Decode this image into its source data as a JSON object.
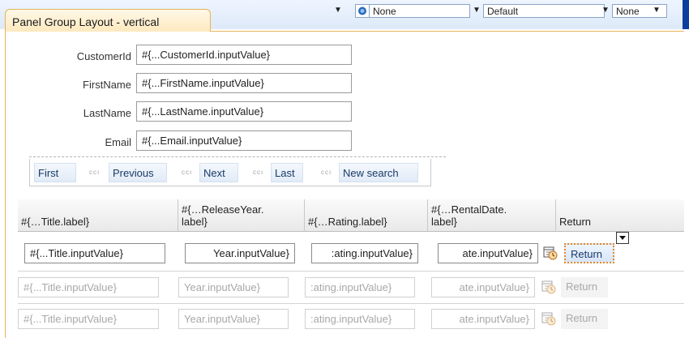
{
  "toolbar": {
    "dropdown1_value": "None",
    "dropdown2_value": "Default",
    "dropdown3_value": "None"
  },
  "panel": {
    "title": "Panel Group Layout - vertical"
  },
  "form": {
    "fields": [
      {
        "label": "CustomerId",
        "value": "#{...CustomerId.inputValue}"
      },
      {
        "label": "FirstName",
        "value": "#{...FirstName.inputValue}"
      },
      {
        "label": "LastName",
        "value": "#{...LastName.inputValue}"
      },
      {
        "label": "Email",
        "value": "#{...Email.inputValue}"
      }
    ]
  },
  "nav": {
    "first": "First",
    "previous": "Previous",
    "next": "Next",
    "last": "Last",
    "new_search": "New search",
    "separator": "ccı"
  },
  "table": {
    "headers": [
      "#{…Title.label}",
      "#{…ReleaseYear.\nlabel}",
      "#{…Rating.label}",
      "#{…RentalDate.\nlabel}",
      "Return"
    ],
    "rows": [
      {
        "title": "#{...Title.inputValue}",
        "year": "Year.inputValue}",
        "rating": ":ating.inputValue}",
        "date": "ate.inputValue}",
        "return": "Return",
        "active": true
      },
      {
        "title": "#{...Title.inputValue}",
        "year": "Year.inputValue}",
        "rating": ":ating.inputValue}",
        "date": "ate.inputValue}",
        "return": "Return",
        "active": false
      },
      {
        "title": "#{...Title.inputValue}",
        "year": "Year.inputValue}",
        "rating": ":ating.inputValue}",
        "date": "ate.inputValue}",
        "return": "Return",
        "active": false
      }
    ]
  },
  "colors": {
    "panel_border": "#e7b35a",
    "focus_outline": "#e4882a",
    "link_text": "#1a3a66"
  }
}
